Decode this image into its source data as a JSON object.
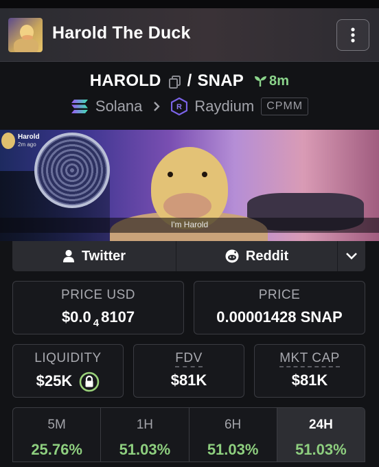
{
  "header": {
    "title": "Harold The Duck"
  },
  "pair": {
    "base": "HAROLD",
    "separator": "/",
    "quote": "SNAP",
    "age": "8m"
  },
  "chain": {
    "name": "Solana",
    "dex": "Raydium",
    "pool_type": "CPMM"
  },
  "banner": {
    "poster_name": "Harold",
    "poster_time": "2m ago",
    "caption": "I'm Harold"
  },
  "social": {
    "twitter_label": "Twitter",
    "reddit_label": "Reddit"
  },
  "price_usd": {
    "label": "PRICE USD",
    "prefix": "$0.0",
    "sub": "4",
    "suffix": "8107"
  },
  "price_native": {
    "label": "PRICE",
    "value": "0.00001428 SNAP"
  },
  "liquidity": {
    "label": "LIQUIDITY",
    "value": "$25K"
  },
  "fdv": {
    "label": "FDV",
    "value": "$81K"
  },
  "mkt_cap": {
    "label": "MKT CAP",
    "value": "$81K"
  },
  "changes": [
    {
      "label": "5M",
      "value": "25.76%"
    },
    {
      "label": "1H",
      "value": "51.03%"
    },
    {
      "label": "6H",
      "value": "51.03%"
    },
    {
      "label": "24H",
      "value": "51.03%",
      "active": true
    }
  ],
  "colors": {
    "positive": "#8ecf7f",
    "age_green": "#8bd48b",
    "lock_ring": "#9ad27a"
  }
}
